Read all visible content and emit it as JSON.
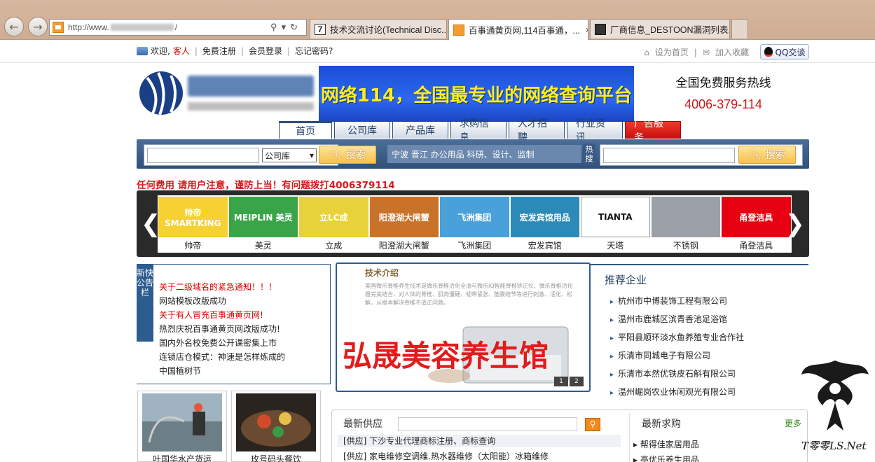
{
  "browser": {
    "address": "http://www.",
    "tabs": [
      {
        "title": "技术交流讨论(Technical Disc..."
      },
      {
        "title": "百事通黄页网,114百事通，..."
      },
      {
        "title": "厂商信息_DESTOON漏洞列表..."
      }
    ],
    "close_glyph": "×"
  },
  "topbar": {
    "welcome": "欢迎,",
    "guest": "客人",
    "links": [
      "免费注册",
      "会员登录",
      "忘记密码?"
    ],
    "set_home": "设为首页",
    "favorite": "加入收藏",
    "qq": "QQ交谈"
  },
  "header": {
    "banner_text": "网络114，全国最专业的网络查询平台",
    "hotline_title": "全国免费服务热线",
    "hotline_number": "4006-379-114"
  },
  "nav": [
    "首页",
    "公司库",
    "产品库",
    "求购信息",
    "人才招聘",
    "行业资讯",
    "广告服务"
  ],
  "search": {
    "select_value": "公司库",
    "button": "搜索",
    "hotwords": "宁波 晋江 办公用品 科研、设计、监制",
    "hot_label": "热搜"
  },
  "warning": "任何费用 请用户注意，谨防上当！有问题拨打4006379114",
  "logos": [
    {
      "caption": "帅帝",
      "art": "帅帝 SMARTKING",
      "color": "#f5d232"
    },
    {
      "caption": "美灵",
      "art": "MEIPLIN 美灵",
      "color": "#3aa548"
    },
    {
      "caption": "立成",
      "art": "立LC成",
      "color": "#e8d23a"
    },
    {
      "caption": "阳澄湖大闸蟹",
      "art": "阳澄湖大闸蟹",
      "color": "#c9732a"
    },
    {
      "caption": "飞洲集团",
      "art": "飞洲集团",
      "color": "#4aa0d8"
    },
    {
      "caption": "宏发宾馆",
      "art": "宏发宾馆用品",
      "color": "#2c8ab8"
    },
    {
      "caption": "天塔",
      "art": "TIANTA",
      "color": "#ffffff"
    },
    {
      "caption": "不锈钢",
      "art": "",
      "color": "#9aa0a6"
    },
    {
      "caption": "甬登洁具",
      "art": "甬登洁具",
      "color": "#e60012"
    }
  ],
  "news": {
    "tag": "新快公告栏",
    "items": [
      {
        "text": "关于二级域名的紧急通知！！！",
        "red": true
      },
      {
        "text": "网站模板改版成功",
        "red": false
      },
      {
        "text": "关于有人冒充百事通黄页网!",
        "red": true
      },
      {
        "text": "热烈庆祝百事通黄页网改版成功!",
        "red": false
      },
      {
        "text": "国内外名校免费公开课密集上市",
        "red": false
      },
      {
        "text": "连锁店仓模式：神速是怎样炼成的",
        "red": false
      },
      {
        "text": "中国植树节",
        "red": false
      }
    ]
  },
  "carousel": {
    "heading": "技术介绍",
    "body": "美国微乐脊椎养生技术是微乐脊椎活化全油与微乐IQ智能脊椎矫正仪、微乐脊椎活化器完美结合，对人体的脊椎、肌肉僵硬、韧带紧张、筋膜结节等进行刺激、活化、松解，从根本解决脊椎不适正问题。",
    "big_text": "弘晟美容养生馆",
    "pages": [
      "1",
      "2"
    ]
  },
  "recommended": {
    "title": "推荐企业",
    "items": [
      "杭州市中博装饰工程有限公司",
      "温州市鹿城区滨青香池足浴馆",
      "平阳县顺环淡水鱼养殖专业合作社",
      "乐清市同城电子有限公司",
      "乐清市本然优铁皮石斛有限公司",
      "温州崛岗农业休闲观光有限公司"
    ]
  },
  "photos": [
    {
      "caption": "叶国华水产货运"
    },
    {
      "caption": "玫号码头餐饮"
    }
  ],
  "supply": {
    "title": "最新供应",
    "rows": [
      "[供应] 下沙专业代理商标注册、商标查询",
      "[供应] 家电维修空调维.热水器维修（太阳能）冰箱维修"
    ]
  },
  "demand": {
    "title": "最新求购",
    "more": "更多",
    "rows": [
      "帮得佳家居用品",
      "亭优乐养生用品"
    ]
  },
  "watermark": "T零零LS.Net"
}
